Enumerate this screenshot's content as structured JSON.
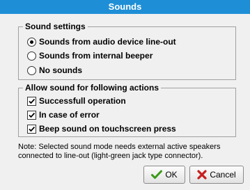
{
  "window": {
    "title": "Sounds"
  },
  "sound_settings": {
    "legend": "Sound settings",
    "options": [
      {
        "label": "Sounds from audio device line-out",
        "checked": true
      },
      {
        "label": "Sounds from internal beeper",
        "checked": false
      },
      {
        "label": "No sounds",
        "checked": false
      }
    ]
  },
  "actions": {
    "legend": "Allow sound for following actions",
    "items": [
      {
        "label": "Successfull operation",
        "checked": true
      },
      {
        "label": "In case of error",
        "checked": true
      },
      {
        "label": "Beep sound on touchscreen press",
        "checked": true
      }
    ]
  },
  "note": "Note: Selected sound mode needs external active speakers connected to line-out (light-green jack type connector).",
  "buttons": {
    "ok_label": "OK",
    "cancel_label": "Cancel"
  },
  "colors": {
    "titlebar": "#1e8fd6",
    "ok_icon": "#3a9a1a",
    "cancel_icon": "#c81e1e"
  }
}
